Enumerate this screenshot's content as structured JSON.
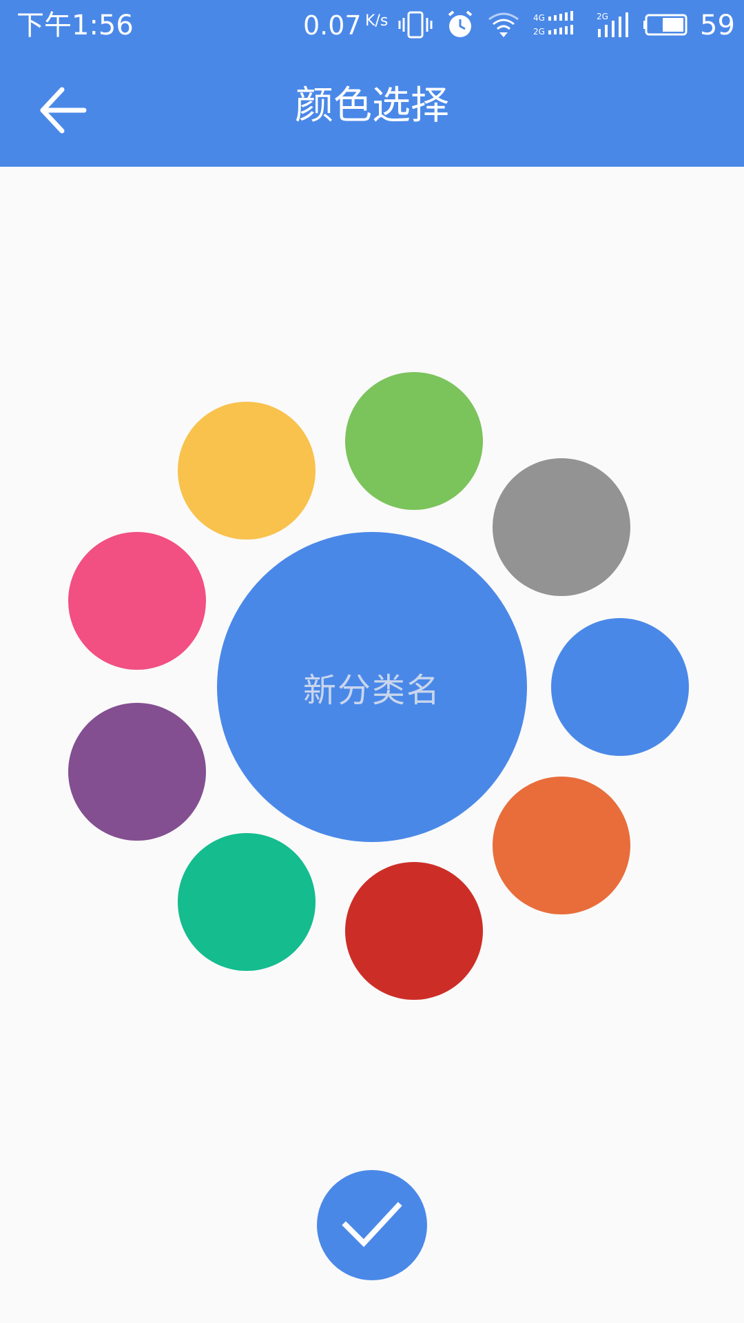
{
  "colors": {
    "header_bg": "#4a88e8",
    "background": "#fafafa",
    "icon": "#ffffff"
  },
  "status_bar": {
    "time": "下午1:56",
    "net_speed": "0.07",
    "net_speed_unit": "K/s",
    "battery_level": "59",
    "icons": [
      "vibrate-icon",
      "alarm-icon",
      "wifi-icon",
      "signal-4g-2g-icon",
      "signal-2g-icon",
      "battery-icon"
    ]
  },
  "app_bar": {
    "back_icon": "arrow-left-icon",
    "title": "颜色选择"
  },
  "picker": {
    "selected": {
      "label": "新分类名",
      "color": "#4a88e8"
    },
    "swatches": [
      {
        "name": "yellow",
        "color": "#f8c24d"
      },
      {
        "name": "green",
        "color": "#7bc35b"
      },
      {
        "name": "gray",
        "color": "#939393"
      },
      {
        "name": "blue",
        "color": "#4a88e8"
      },
      {
        "name": "orange",
        "color": "#e86d3b"
      },
      {
        "name": "red",
        "color": "#cc2e27"
      },
      {
        "name": "teal",
        "color": "#14bc8e"
      },
      {
        "name": "purple",
        "color": "#834f91"
      },
      {
        "name": "pink",
        "color": "#f24f82"
      }
    ]
  },
  "confirm": {
    "icon": "checkmark-icon",
    "color": "#4a88e8"
  }
}
